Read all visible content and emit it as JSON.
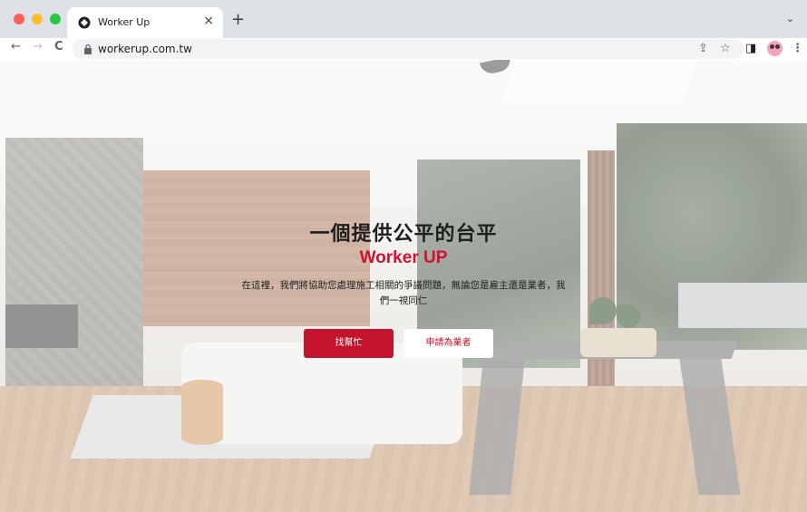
{
  "browser": {
    "tab_title": "Worker Up",
    "tab_close": "×",
    "new_tab": "+",
    "tab_menu": "⌄",
    "url": "workerup.com.tw",
    "nav": {
      "back": "←",
      "forward": "→",
      "reload": "C"
    },
    "toolbar_icons": {
      "share": "⇪",
      "bookmark": "☆",
      "sidepanel": "◨",
      "menu": "⋮"
    }
  },
  "hero": {
    "headline": "一個提供公平的台平",
    "brand": "Worker UP",
    "description": "在這裡，我們將協助您處理施工相關的爭議問題，無論您是雇主還是業者，我們一視同仁",
    "primary_button": "找幫忙",
    "secondary_button": "申請為業者"
  },
  "colors": {
    "accent_red": "#c4132d",
    "brand_red": "#d4112e"
  }
}
